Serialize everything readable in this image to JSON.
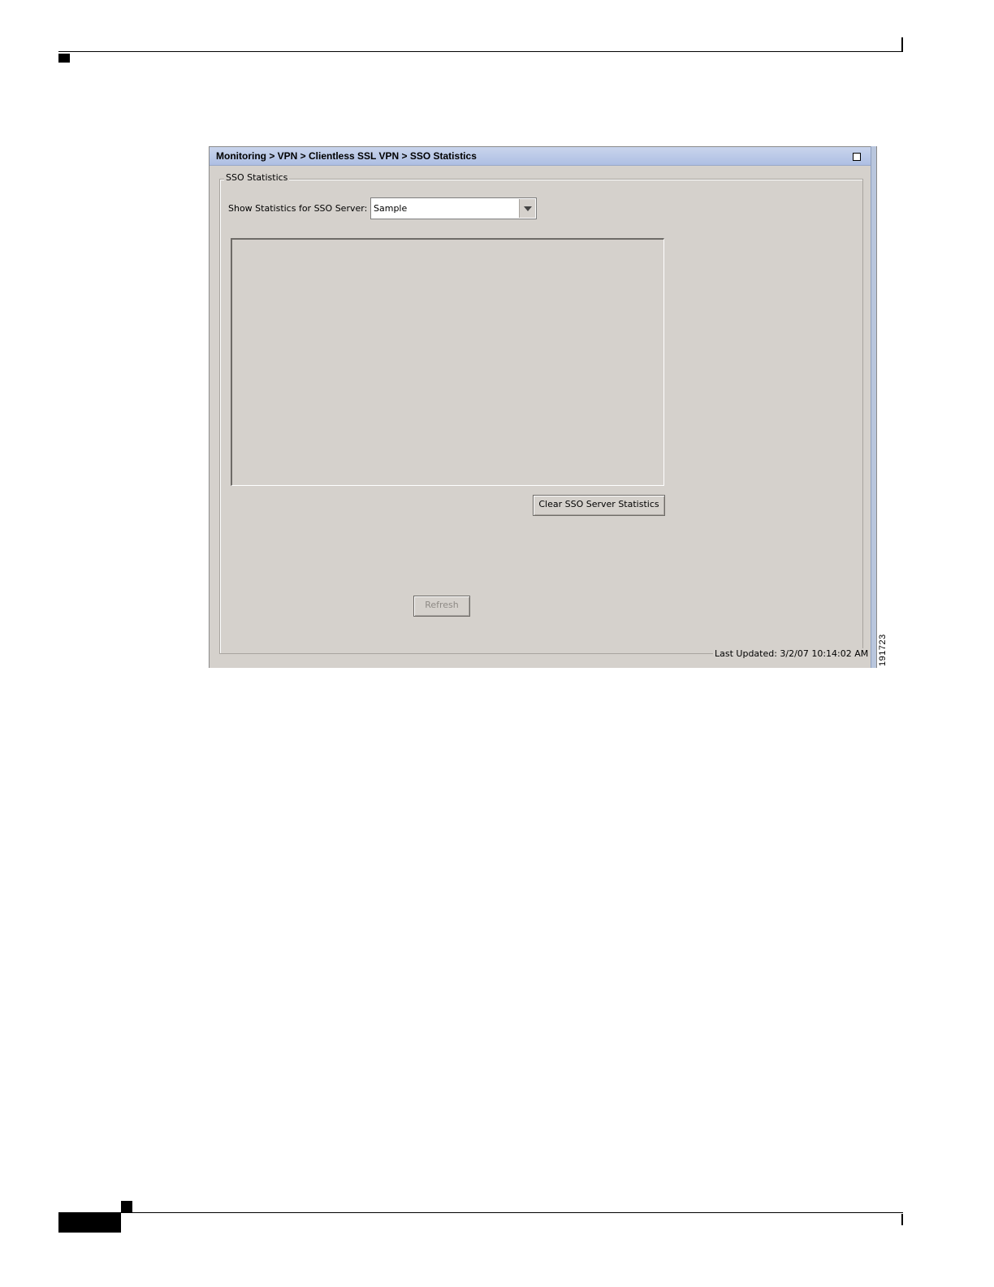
{
  "window": {
    "breadcrumb": "Monitoring > VPN > Clientless SSL VPN > SSO Statistics"
  },
  "group": {
    "legend": "SSO Statistics"
  },
  "server_selector": {
    "label": "Show Statistics for SSO Server:",
    "selected_value": "Sample"
  },
  "buttons": {
    "clear_label": "Clear SSO Server Statistics",
    "refresh_label": "Refresh"
  },
  "status": {
    "last_updated": "Last Updated: 3/2/07 10:14:02 AM"
  },
  "figure": {
    "id": "191723"
  },
  "icons": {
    "maximize": "maximize-icon",
    "dropdown": "chevron-down-icon"
  }
}
